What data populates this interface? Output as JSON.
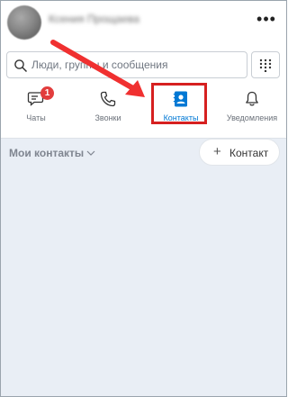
{
  "header": {
    "username": "Ксения Прощаева",
    "more_label": "•••"
  },
  "search": {
    "placeholder": "Люди, группы и сообщения"
  },
  "tabs": [
    {
      "label": "Чаты",
      "badge": "1",
      "icon": "chat-icon"
    },
    {
      "label": "Звонки",
      "icon": "phone-icon"
    },
    {
      "label": "Контакты",
      "icon": "contacts-icon",
      "selected": true
    },
    {
      "label": "Уведомления",
      "icon": "bell-icon"
    }
  ],
  "contacts": {
    "section_title": "Мои контакты",
    "add_button_label": "Контакт",
    "add_button_icon": "+"
  },
  "colors": {
    "accent": "#0078d4",
    "highlight": "#d62020",
    "badge": "#e23d3d",
    "background": "#e9eef5"
  }
}
